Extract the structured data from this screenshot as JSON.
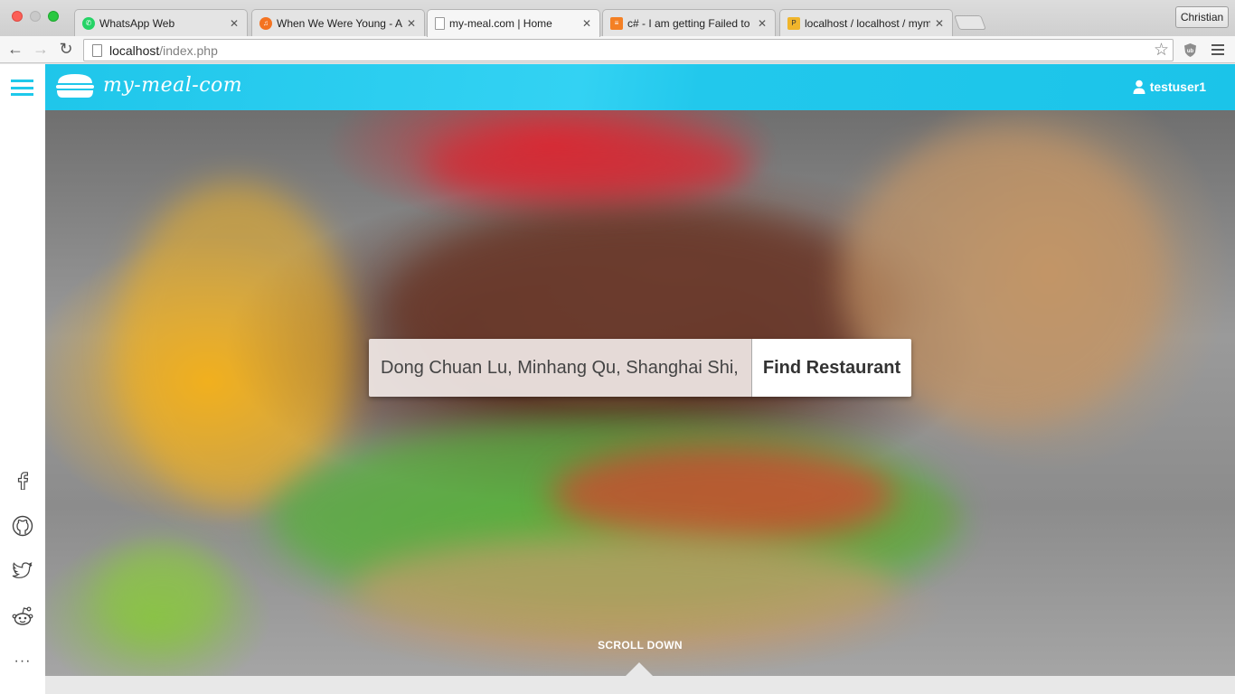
{
  "browser": {
    "tabs": [
      {
        "title": "WhatsApp Web",
        "icon": "whatsapp-icon"
      },
      {
        "title": "When We Were Young - Ad",
        "icon": "headphones-icon"
      },
      {
        "title": "my-meal.com | Home",
        "icon": "page-icon"
      },
      {
        "title": "c# - I am getting Failed to l",
        "icon": "stackoverflow-icon"
      },
      {
        "title": "localhost / localhost / mym",
        "icon": "phpmyadmin-icon"
      }
    ],
    "active_tab": 2,
    "profile_name": "Christian",
    "url_host": "localhost",
    "url_path": "/index.php"
  },
  "header": {
    "logo_text": "my-meal-com",
    "username": "testuser1",
    "accent_color": "#1fc6ea"
  },
  "search": {
    "value": "Dong Chuan Lu, Minhang Qu, Shanghai Shi,",
    "button_label": "Find Restaurant"
  },
  "sidebar": {
    "social": [
      "facebook-icon",
      "github-icon",
      "twitter-icon",
      "reddit-icon",
      "more-icon"
    ],
    "more_label": "···"
  },
  "hero": {
    "scroll_label": "SCROLL DOWN"
  }
}
